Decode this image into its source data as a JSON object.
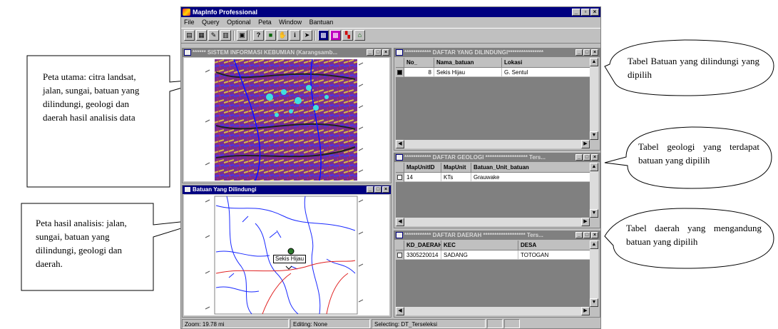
{
  "app": {
    "title": "MapInfo Professional",
    "menu": [
      "File",
      "Query",
      "Optional",
      "Peta",
      "Window",
      "Bantuan"
    ],
    "toolbar_icons": [
      "print-icon",
      "open-table-icon",
      "layer-control-icon",
      "browser-icon",
      "map-icon",
      "help-icon",
      "grabber-icon",
      "hand-icon",
      "info-icon",
      "select-arrow-icon",
      "zoom-in-icon",
      "zoom-out-icon",
      "thematic-icon",
      "region-icon"
    ]
  },
  "windows": {
    "main_map": {
      "title": "****** SISTEM INFORMASI KEBUMIAN (Karangsamb..."
    },
    "result_map": {
      "title": "Batuan Yang Dilindungi",
      "label": "Sekis Hijau"
    },
    "protected_table": {
      "title": "************ DAFTAR YANG DILINDUNGI****************",
      "columns": [
        "No_",
        "Nama_batuan",
        "Lokasi"
      ],
      "rows": [
        {
          "cells": [
            "8",
            "Sekis Hijau",
            "G. Sentul"
          ]
        }
      ]
    },
    "geology_table": {
      "title": "************ DAFTAR GEOLOGI ******************* Ters...",
      "columns": [
        "MapUnitID",
        "MapUnit",
        "Batuan_Unit_batuan"
      ],
      "rows": [
        {
          "cells": [
            "14",
            "KTs",
            "Grauwake"
          ]
        }
      ]
    },
    "area_table": {
      "title": "************ DAFTAR DAERAH ******************* Ters...",
      "columns": [
        "KD_DAERAH",
        "KEC",
        "DESA"
      ],
      "rows": [
        {
          "cells": [
            "3305220014",
            "SADANG",
            "TOTOGAN"
          ]
        }
      ]
    }
  },
  "status": {
    "zoom": "Zoom: 19.78 mi",
    "editing": "Editing: None",
    "selecting": "Selecting: DT_Terseleksi"
  },
  "callouts": {
    "main_map": "Peta utama: citra landsat, jalan, sungai, batuan yang dilindungi, geologi dan daerah hasil analisis data",
    "result_map": "Peta hasil analisis: jalan, sungai, batuan yang dilindungi, geologi dan daerah.",
    "protected": "Tabel Batuan yang dilindungi yang dipilih",
    "geology": "Tabel geologi yang terdapat batuan yang dipilih",
    "area": "Tabel daerah yang mengandung batuan yang dipilih"
  },
  "colors": {
    "title_active": "#000080",
    "title_inactive": "#808080",
    "chrome": "#c0c0c0"
  }
}
